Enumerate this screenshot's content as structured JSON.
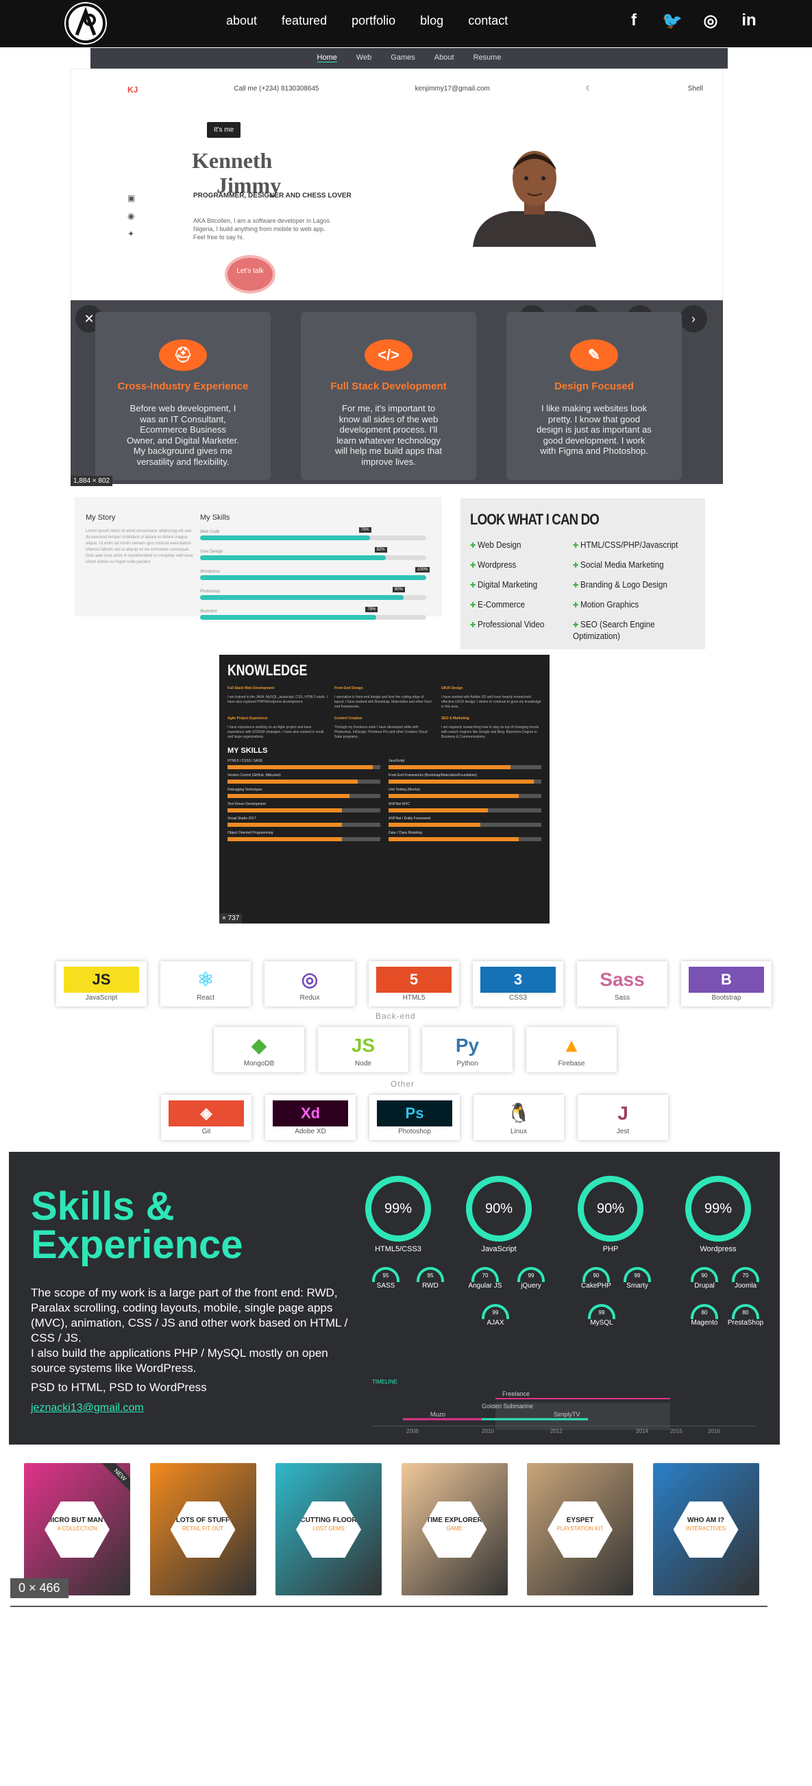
{
  "nav": {
    "links": [
      "about",
      "featured",
      "portfolio",
      "blog",
      "contact"
    ],
    "social": [
      "f",
      "t",
      "d",
      "in"
    ]
  },
  "hero": {
    "mini_tabs": [
      "Home",
      "Web",
      "Games",
      "About",
      "Resume"
    ],
    "logo_text": "KJ",
    "phone": "Call me (+234) 8130308645",
    "email": "kenjimmy17@gmail.com",
    "top_right": "Shell",
    "itsme": "It's me",
    "first_name": "Kenneth",
    "last_name": "Jimmy",
    "subtitle": "PROGRAMMER, DESIGNER AND CHESS LOVER",
    "bio": "AKA Bitcollen, I am a software developer in Lagos Nigeria, I build anything from mobile to web app. Feel free to say hi.",
    "cta": "Let's talk",
    "size_tag": "1,884 × 802"
  },
  "cards": [
    {
      "icon": "helmet-icon",
      "glyph": "⛑",
      "title": "Cross-Industry Experience",
      "text": "Before web development, I was an IT Consultant, Ecommerce Business Owner, and Digital Marketer. My background gives me versatility and flexibility."
    },
    {
      "icon": "code-icon",
      "glyph": "</>",
      "title": "Full Stack Development",
      "text": "For me, it's important to know all sides of the web development process. I'll learn whatever technology will help me build apps that improve lives."
    },
    {
      "icon": "brush-icon",
      "glyph": "✎",
      "title": "Design Focused",
      "text": "I like making websites look pretty. I know that good design is just as important as good development. I work with Figma and Photoshop."
    }
  ],
  "story": {
    "title": "My Story",
    "skills_title": "My Skills",
    "text": "Lorem ipsum dolor sit amet consectetur adipiscing elit sed do eiusmod tempor incididunt ut labore et dolore magna aliqua. Ut enim ad minim veniam quis nostrud exercitation ullamco laboris nisi ut aliquip ex ea commodo consequat. Duis aute irure dolor in reprehenderit in voluptate velit esse cillum dolore eu fugiat nulla pariatur.",
    "skills": [
      {
        "name": "Web Code",
        "value": 75
      },
      {
        "name": "User Design",
        "value": 82
      },
      {
        "name": "Wordpress",
        "value": 100
      },
      {
        "name": "Photoshop",
        "value": 90
      },
      {
        "name": "Illustrator",
        "value": 78
      }
    ]
  },
  "lookwhat": {
    "title": "LOOK WHAT I CAN DO",
    "col1": [
      "Web Design",
      "Wordpress",
      "Digital Marketing",
      "E-Commerce",
      "Professional Video"
    ],
    "col2": [
      "HTML/CSS/PHP/Javascript",
      "Social Media Marketing",
      "Branding & Logo Design",
      "Motion Graphics",
      "SEO (Search Engine Optimization)"
    ]
  },
  "knowledge": {
    "title": "KNOWLEDGE",
    "items": [
      {
        "title": "Full Stack Web Development",
        "text": "I am trained in the JAVA, MySQL, javascript, CSS, HTML5 stack. I have also explored PHP/Wordpress development."
      },
      {
        "title": "Front End Design",
        "text": "I specialize in front-end design and love the cutting edge of layout. I have worked with Bootstrap, Materialize and other front-end frameworks."
      },
      {
        "title": "UI/UX Design",
        "text": "I have worked with Adobe XD and have heavily researched effective UI/UX design. I desire to continue to grow my knowledge in this area."
      },
      {
        "title": "Agile Project Experience",
        "text": "I have experience working on an Agile project and have experience with SCRUM strategies. I have also worked in small and large organizations."
      },
      {
        "title": "Content Creation",
        "text": "Through my freelance work I have developed skills with Photoshop, InDesign, Premiere Pro and other Creative Cloud Suite programs."
      },
      {
        "title": "SEO & Marketing",
        "text": "I am regularly researching how to stay on top of changing trends with search engines like Google and Bing. Bachelors Degree in Business & Communications."
      }
    ],
    "skills_title": "MY SKILLS",
    "skills": [
      {
        "name": "HTML5 / CSS3 / SASS",
        "value": 95
      },
      {
        "name": "JavaScript",
        "value": 80
      },
      {
        "name": "Version Control (GitHub, Bitbucket)",
        "value": 85
      },
      {
        "name": "Front End Frameworks (Bootstrap/Materialize/Foundation)",
        "value": 95
      },
      {
        "name": "Debugging Techniques",
        "value": 80
      },
      {
        "name": "Unit Testing (Mocha)",
        "value": 85
      },
      {
        "name": "Test Driven Development",
        "value": 75
      },
      {
        "name": "ASP.Net MVC",
        "value": 65
      },
      {
        "name": "Visual Studio 2017",
        "value": 75
      },
      {
        "name": "ASP.Net / Entity Framework",
        "value": 60
      },
      {
        "name": "Object Oriented Programming",
        "value": 75
      },
      {
        "name": "Data / Class Modeling",
        "value": 85
      }
    ],
    "size_tag": "× 737"
  },
  "tech": {
    "row1": [
      {
        "name": "JavaScript",
        "logo": "JS",
        "bg": "#f7df1e",
        "fg": "#222"
      },
      {
        "name": "React",
        "logo": "⚛",
        "bg": "#ffffff",
        "fg": "#61dafb"
      },
      {
        "name": "Redux",
        "logo": "◎",
        "bg": "#ffffff",
        "fg": "#764abc"
      },
      {
        "name": "HTML5",
        "logo": "5",
        "bg": "#e44d26",
        "fg": "#fff"
      },
      {
        "name": "CSS3",
        "logo": "3",
        "bg": "#1572b6",
        "fg": "#fff"
      },
      {
        "name": "Sass",
        "logo": "Sass",
        "bg": "#ffffff",
        "fg": "#cd6799"
      },
      {
        "name": "Bootstrap",
        "logo": "B",
        "bg": "#7952b3",
        "fg": "#fff"
      }
    ],
    "backend_label": "Back-end",
    "row2": [
      {
        "name": "MongoDB",
        "logo": "◆",
        "bg": "#ffffff",
        "fg": "#4db33d"
      },
      {
        "name": "Node",
        "logo": "JS",
        "bg": "#ffffff",
        "fg": "#83cd29"
      },
      {
        "name": "Python",
        "logo": "Py",
        "bg": "#ffffff",
        "fg": "#3776ab"
      },
      {
        "name": "Firebase",
        "logo": "▲",
        "bg": "#ffffff",
        "fg": "#ffa000"
      }
    ],
    "other_label": "Other",
    "row3": [
      {
        "name": "Git",
        "logo": "◈",
        "bg": "#e84e31",
        "fg": "#fff"
      },
      {
        "name": "Adobe XD",
        "logo": "Xd",
        "bg": "#2e001f",
        "fg": "#ff61f6"
      },
      {
        "name": "Photoshop",
        "logo": "Ps",
        "bg": "#001d26",
        "fg": "#31c5f0"
      },
      {
        "name": "Linux",
        "logo": "🐧",
        "bg": "#ffffff",
        "fg": "#222"
      },
      {
        "name": "Jest",
        "logo": "J",
        "bg": "#ffffff",
        "fg": "#99425b"
      }
    ]
  },
  "skx": {
    "title_line1": "Skills &",
    "title_line2": "Experience",
    "p1": "The scope of my work is a large part of the front end: RWD, Paralax scrolling, coding layouts, mobile, single page apps (MVC), animation, CSS / JS and other work based on HTML / CSS / JS.",
    "p2": "I also build the applications PHP / MySQL mostly on open source systems like WordPress.",
    "p3": "PSD to HTML, PSD to WordPress",
    "email": "jeznacki13@gmail.com",
    "big": [
      {
        "label": "HTML5/CSS3",
        "value": "99%"
      },
      {
        "label": "JavaScript",
        "value": "90%"
      },
      {
        "label": "PHP",
        "value": "90%"
      },
      {
        "label": "Wordpress",
        "value": "99%"
      }
    ],
    "small": [
      {
        "label": "SASS",
        "value": "95"
      },
      {
        "label": "RWD",
        "value": "95"
      },
      {
        "label": "Angular JS",
        "value": "70"
      },
      {
        "label": "jQuery",
        "value": "99"
      },
      {
        "label": "CakePHP",
        "value": "90"
      },
      {
        "label": "Smarty",
        "value": "99"
      },
      {
        "label": "Drupal",
        "value": "90"
      },
      {
        "label": "Joomla",
        "value": "70"
      },
      {
        "label": "AJAX",
        "value": "99"
      },
      {
        "label": "MySQL",
        "value": "99"
      },
      {
        "label": "Magento",
        "value": "80"
      },
      {
        "label": "PrestaShop",
        "value": "80"
      }
    ],
    "timeline_label": "TIMELINE",
    "timeline_items": [
      "Freelance",
      "Golden Submarine",
      "Muzo",
      "SimplyTV"
    ],
    "years": [
      "2006",
      "2010",
      "2012",
      "2014",
      "2015",
      "2016"
    ]
  },
  "portfolio": {
    "items": [
      {
        "title": "MICRO BUT MANY",
        "sub": "A COLLECTION",
        "bg": "#e0338a"
      },
      {
        "title": "LOTS OF STUFF",
        "sub": "RETAIL FIT OUT",
        "bg": "#f28a1e"
      },
      {
        "title": "CUTTING FLOOR",
        "sub": "LOST GEMS",
        "bg": "#2fb8c9"
      },
      {
        "title": "TIME EXPLORER",
        "sub": "GAME",
        "bg": "#f0c89a"
      },
      {
        "title": "EYSPET",
        "sub": "PLAYSTATION KIT",
        "bg": "#c9a57a"
      },
      {
        "title": "WHO AM I?",
        "sub": "INTERACTIVES",
        "bg": "#2a7fc7"
      }
    ],
    "ribbon": "NEW",
    "size_tag": "0 × 466"
  }
}
